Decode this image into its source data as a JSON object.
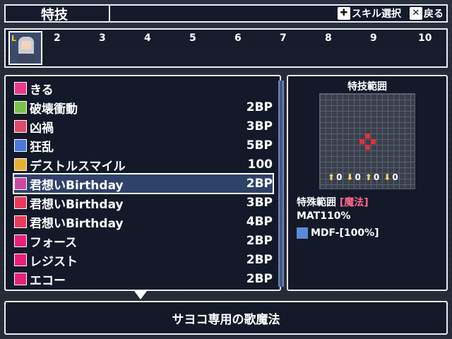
{
  "header": {
    "title": "特技",
    "hint_skill_select": "スキル選択",
    "hint_back": "戻る"
  },
  "party": {
    "slots": [
      "2",
      "3",
      "4",
      "5",
      "6",
      "7",
      "8",
      "9",
      "10"
    ],
    "leader_mark": "L"
  },
  "skills": [
    {
      "name": "きる",
      "cost": "",
      "icon": "sword-icon",
      "color": "#e83a8a"
    },
    {
      "name": "破壊衝動",
      "cost": "2BP",
      "icon": "plus-icon",
      "color": "#7bc24a"
    },
    {
      "name": "凶禍",
      "cost": "3BP",
      "icon": "square-icon",
      "color": "#e04a6a"
    },
    {
      "name": "狂乱",
      "cost": "5BP",
      "icon": "square-icon",
      "color": "#4a78d8"
    },
    {
      "name": "デストルスマイル",
      "cost": "100",
      "icon": "star-icon",
      "color": "#e8b030"
    },
    {
      "name": "君想いBirthday",
      "cost": "2BP",
      "icon": "note-icon",
      "color": "#c84aa0"
    },
    {
      "name": "君想いBirthday",
      "cost": "3BP",
      "icon": "note-icon",
      "color": "#e83a5a"
    },
    {
      "name": "君想いBirthday",
      "cost": "4BP",
      "icon": "note-icon",
      "color": "#e83a5a"
    },
    {
      "name": "フォース",
      "cost": "2BP",
      "icon": "vo-icon",
      "color": "#e8207a"
    },
    {
      "name": "レジスト",
      "cost": "2BP",
      "icon": "vo-icon",
      "color": "#e8207a"
    },
    {
      "name": "エコー",
      "cost": "2BP",
      "icon": "vo-icon",
      "color": "#e8207a"
    }
  ],
  "selected_index": 5,
  "range": {
    "title": "特技範囲",
    "arrows": [
      "0",
      "0",
      "0",
      "0"
    ],
    "special_range_label": "特殊範囲",
    "special_range_value": "[魔法]",
    "mat": "MAT110%",
    "mdf": "MDF-[100%]"
  },
  "description": "サヨコ専用の歌魔法"
}
